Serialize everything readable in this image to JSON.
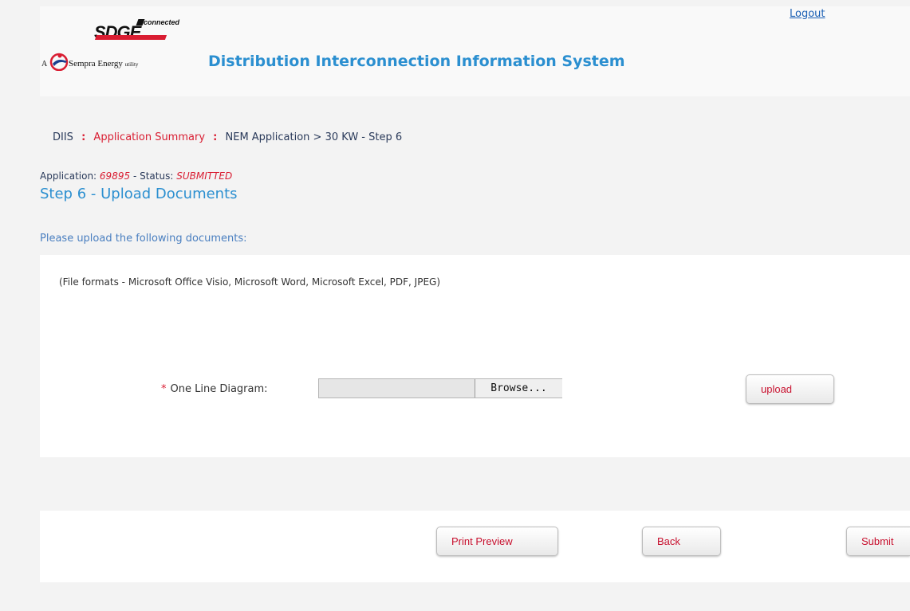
{
  "header": {
    "logo": {
      "brand": "SDGE",
      "tag": "connected",
      "prefix": "A",
      "parent": "Sempra Energy",
      "parent_suffix": "utility"
    },
    "system_title": "Distribution Interconnection Information System",
    "logout_label": "Logout"
  },
  "breadcrumb": {
    "root": "DIIS",
    "item1": "Application Summary",
    "item2": "NEM Application > 30 KW - Step 6"
  },
  "application": {
    "label": "Application:",
    "number": "69895",
    "status_label": "- Status:",
    "status": "SUBMITTED"
  },
  "step_title": "Step 6 - Upload Documents",
  "instructions": "Please upload the following documents:",
  "upload_panel": {
    "formats_note": "(File formats - Microsoft Office Visio, Microsoft Word, Microsoft Excel, PDF, JPEG)",
    "required_mark": "*",
    "field_label": "One Line Diagram:",
    "browse_label": "Browse...",
    "upload_label": "upload"
  },
  "footer": {
    "print_preview_label": "Print Preview",
    "back_label": "Back",
    "submit_label": "Submit"
  },
  "colors": {
    "accent_blue": "#2b8fd0",
    "accent_red": "#d91d32",
    "background": "#f3f3f3"
  }
}
